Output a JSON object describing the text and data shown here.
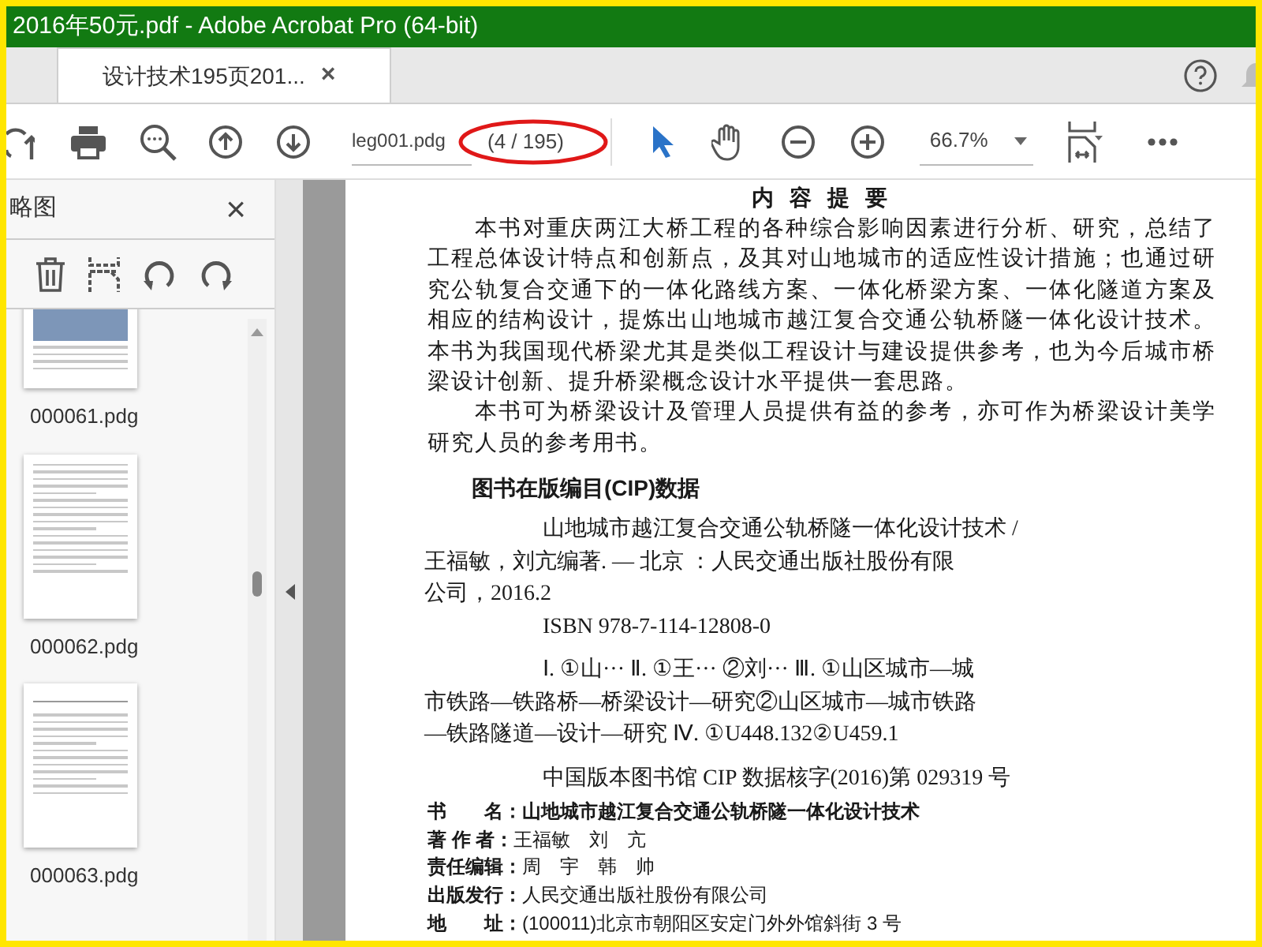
{
  "window": {
    "title": "2016年50元.pdf - Adobe Acrobat Pro (64-bit)"
  },
  "tabs": [
    {
      "label": "设计技术195页201...",
      "selected": true,
      "close": "×"
    }
  ],
  "toolbar": {
    "file_field": "leg001.pdg",
    "page_count": "(4 / 195)",
    "zoom": "66.7%"
  },
  "sidebar": {
    "title": "略图",
    "close": "×",
    "thumbnails": [
      {
        "label": "000061.pdg",
        "kind": "photo"
      },
      {
        "label": "000062.pdg",
        "kind": "text"
      },
      {
        "label": "000063.pdg",
        "kind": "figure"
      }
    ]
  },
  "page": {
    "heading": "内 容 提 要",
    "paragraphs": [
      "本书对重庆两江大桥工程的各种综合影响因素进行分析、研究，总结了工程总体设计特点和创新点，及其对山地城市的适应性设计措施；也通过研究公轨复合交通下的一体化路线方案、一体化桥梁方案、一体化隧道方案及相应的结构设计，提炼出山地城市越江复合交通公轨桥隧一体化设计技术。本书为我国现代桥梁尤其是类似工程设计与建设提供参考，也为今后城市桥梁设计创新、提升桥梁概念设计水平提供一套思路。",
      "本书可为桥梁设计及管理人员提供有益的参考，亦可作为桥梁设计美学研究人员的参考用书。"
    ],
    "cip_heading": "图书在版编目(CIP)数据",
    "cip_blocks": [
      [
        "山地城市越江复合交通公轨桥隧一体化设计技术 /",
        "王福敏，刘亢编著. — 北京 ：人民交通出版社股份有限",
        "公司，2016.2"
      ],
      [
        "ISBN  978-7-114-12808-0"
      ],
      [
        "Ⅰ. ①山···   Ⅱ. ①王··· ②刘···   Ⅲ. ①山区城市—城",
        "市铁路—铁路桥—桥梁设计—研究②山区城市—城市铁路",
        "—铁路隧道—设计—研究   Ⅳ. ①U448.132②U459.1"
      ],
      [
        "中国版本图书馆 CIP 数据核字(2016)第 029319 号"
      ]
    ],
    "details": [
      {
        "label": "书　　名：",
        "value": "山地城市越江复合交通公轨桥隧一体化设计技术",
        "bold": true
      },
      {
        "label": "著 作 者：",
        "value": "王福敏　刘　亢",
        "bold": false
      },
      {
        "label": "责任编辑：",
        "value": "周　宇　韩　帅",
        "bold": false
      },
      {
        "label": "出版发行：",
        "value": "人民交通出版社股份有限公司",
        "bold": false
      },
      {
        "label": "地　　址：",
        "value": "(100011)北京市朝阳区安定门外外馆斜街 3 号",
        "bold": false
      }
    ]
  }
}
